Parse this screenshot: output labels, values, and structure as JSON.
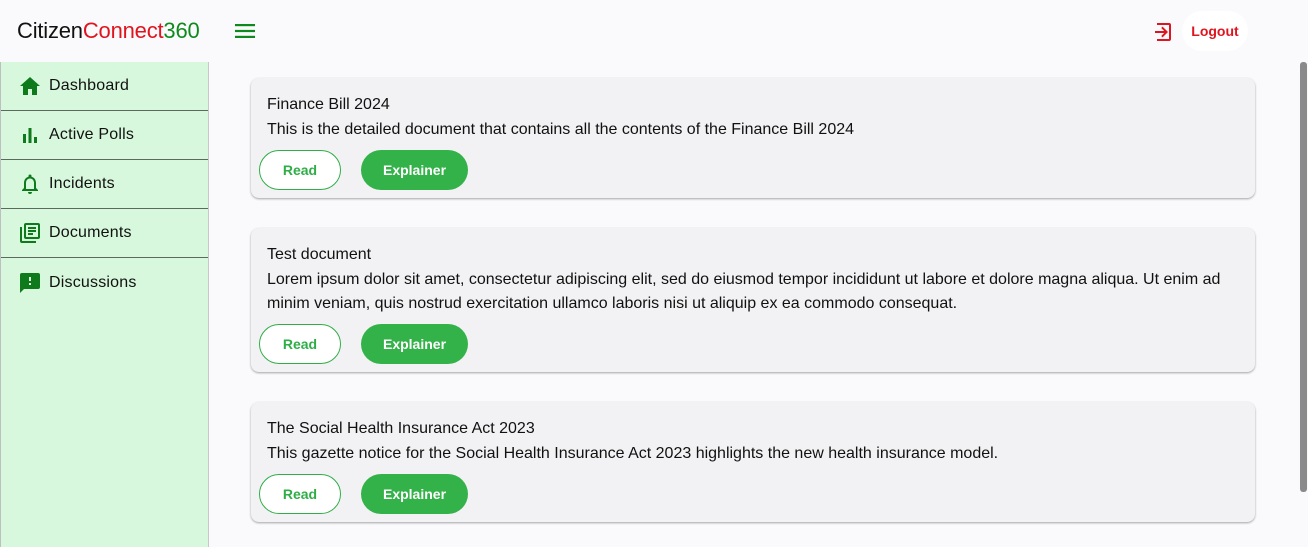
{
  "brand": {
    "part1": "Citizen",
    "part2": "Connect",
    "part3": "360"
  },
  "header": {
    "logout_label": "Logout"
  },
  "colors": {
    "brand_red": "#e0141e",
    "brand_green": "#0e8a1c",
    "accent_green": "#34b24a",
    "sidebar_bg": "#d7f8dc"
  },
  "sidebar": {
    "items": [
      {
        "label": "Dashboard",
        "icon": "home-icon"
      },
      {
        "label": "Active Polls",
        "icon": "bar-chart-icon"
      },
      {
        "label": "Incidents",
        "icon": "bell-icon"
      },
      {
        "label": "Documents",
        "icon": "library-books-icon"
      },
      {
        "label": "Discussions",
        "icon": "feedback-icon"
      }
    ]
  },
  "documents": [
    {
      "title": "Finance Bill 2024",
      "description": "This is the detailed document that contains all the contents of the Finance Bill 2024",
      "read_label": "Read",
      "explainer_label": "Explainer"
    },
    {
      "title": "Test document",
      "description": "Lorem ipsum dolor sit amet, consectetur adipiscing elit, sed do eiusmod tempor incididunt ut labore et dolore magna aliqua. Ut enim ad minim veniam, quis nostrud exercitation ullamco laboris nisi ut aliquip ex ea commodo consequat.",
      "read_label": "Read",
      "explainer_label": "Explainer"
    },
    {
      "title": "The Social Health Insurance Act 2023",
      "description": "This gazette notice for the Social Health Insurance Act 2023 highlights the new health insurance model.",
      "read_label": "Read",
      "explainer_label": "Explainer"
    }
  ]
}
